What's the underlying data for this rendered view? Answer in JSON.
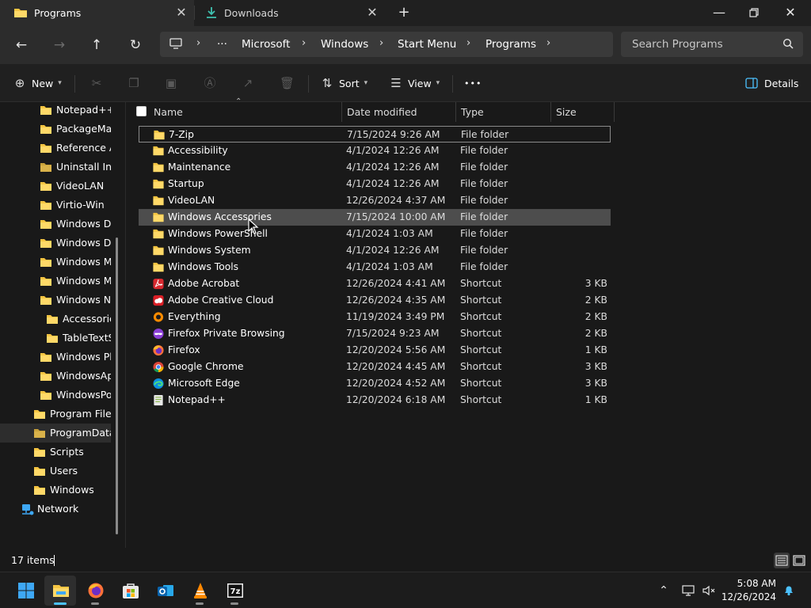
{
  "tabs": [
    {
      "label": "Programs",
      "icon": "folder-icon",
      "active": true
    },
    {
      "label": "Downloads",
      "icon": "download-icon",
      "active": false
    }
  ],
  "address": {
    "crumbs": [
      "Microsoft",
      "Windows",
      "Start Menu",
      "Programs"
    ],
    "overflow": "···"
  },
  "search": {
    "placeholder": "Search Programs"
  },
  "commands": {
    "new": "New",
    "sort": "Sort",
    "view": "View",
    "more": "•••",
    "details": "Details"
  },
  "sidebar": {
    "items": [
      {
        "label": "Notepad++",
        "level": 2
      },
      {
        "label": "PackageMan",
        "level": 2
      },
      {
        "label": "Reference As",
        "level": 2
      },
      {
        "label": "Uninstall Info",
        "level": 2
      },
      {
        "label": "VideoLAN",
        "level": 2
      },
      {
        "label": "Virtio-Win",
        "level": 2
      },
      {
        "label": "Windows Def",
        "level": 2
      },
      {
        "label": "Windows Def",
        "level": 2
      },
      {
        "label": "Windows Ma",
        "level": 2
      },
      {
        "label": "Windows Me",
        "level": 2
      },
      {
        "label": "Windows NT",
        "level": 2
      },
      {
        "label": "Accessories",
        "level": 3
      },
      {
        "label": "TableTextSe",
        "level": 3
      },
      {
        "label": "Windows Pho",
        "level": 2
      },
      {
        "label": "WindowsApp",
        "level": 2
      },
      {
        "label": "WindowsPov",
        "level": 2
      },
      {
        "label": "Program Files",
        "level": 1
      },
      {
        "label": "ProgramData",
        "level": 1,
        "selected": true
      },
      {
        "label": "Scripts",
        "level": 1
      },
      {
        "label": "Users",
        "level": 1
      },
      {
        "label": "Windows",
        "level": 1
      },
      {
        "label": "Network",
        "level": 0
      }
    ]
  },
  "columns": {
    "name": "Name",
    "date": "Date modified",
    "type": "Type",
    "size": "Size"
  },
  "files": [
    {
      "name": "7-Zip",
      "date": "7/15/2024 9:26 AM",
      "type": "File folder",
      "size": "",
      "icon": "folder-icon"
    },
    {
      "name": "Accessibility",
      "date": "4/1/2024 12:26 AM",
      "type": "File folder",
      "size": "",
      "icon": "folder-icon"
    },
    {
      "name": "Maintenance",
      "date": "4/1/2024 12:26 AM",
      "type": "File folder",
      "size": "",
      "icon": "folder-icon"
    },
    {
      "name": "Startup",
      "date": "4/1/2024 12:26 AM",
      "type": "File folder",
      "size": "",
      "icon": "folder-icon"
    },
    {
      "name": "VideoLAN",
      "date": "12/26/2024 4:37 AM",
      "type": "File folder",
      "size": "",
      "icon": "folder-icon"
    },
    {
      "name": "Windows Accessories",
      "date": "7/15/2024 10:00 AM",
      "type": "File folder",
      "size": "",
      "icon": "folder-icon"
    },
    {
      "name": "Windows PowerShell",
      "date": "4/1/2024 1:03 AM",
      "type": "File folder",
      "size": "",
      "icon": "folder-icon"
    },
    {
      "name": "Windows System",
      "date": "4/1/2024 12:26 AM",
      "type": "File folder",
      "size": "",
      "icon": "folder-icon"
    },
    {
      "name": "Windows Tools",
      "date": "4/1/2024 1:03 AM",
      "type": "File folder",
      "size": "",
      "icon": "folder-icon"
    },
    {
      "name": "Adobe Acrobat",
      "date": "12/26/2024 4:41 AM",
      "type": "Shortcut",
      "size": "3 KB",
      "icon": "acrobat-icon"
    },
    {
      "name": "Adobe Creative Cloud",
      "date": "12/26/2024 4:35 AM",
      "type": "Shortcut",
      "size": "2 KB",
      "icon": "creative-cloud-icon"
    },
    {
      "name": "Everything",
      "date": "11/19/2024 3:49 PM",
      "type": "Shortcut",
      "size": "2 KB",
      "icon": "everything-icon"
    },
    {
      "name": "Firefox Private Browsing",
      "date": "7/15/2024 9:23 AM",
      "type": "Shortcut",
      "size": "2 KB",
      "icon": "firefox-private-icon"
    },
    {
      "name": "Firefox",
      "date": "12/20/2024 5:56 AM",
      "type": "Shortcut",
      "size": "1 KB",
      "icon": "firefox-icon"
    },
    {
      "name": "Google Chrome",
      "date": "12/20/2024 4:45 AM",
      "type": "Shortcut",
      "size": "3 KB",
      "icon": "chrome-icon"
    },
    {
      "name": "Microsoft Edge",
      "date": "12/20/2024 4:52 AM",
      "type": "Shortcut",
      "size": "3 KB",
      "icon": "edge-icon"
    },
    {
      "name": "Notepad++",
      "date": "12/20/2024 6:18 AM",
      "type": "Shortcut",
      "size": "1 KB",
      "icon": "notepadpp-icon"
    }
  ],
  "status": {
    "count": "17 items"
  },
  "clock": {
    "time": "5:08 AM",
    "date": "12/26/2024"
  },
  "colors": {
    "folder": "#f5c542",
    "accent": "#4cc2ff",
    "hover_row": "#4d4d4d"
  }
}
